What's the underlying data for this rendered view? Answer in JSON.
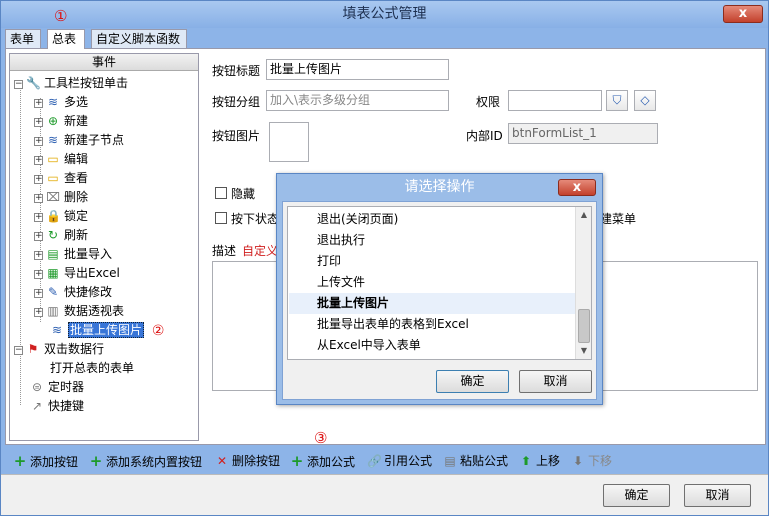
{
  "window": {
    "title": "填表公式管理",
    "close": "x"
  },
  "markers": {
    "m1": "①",
    "m2": "②",
    "m3": "③"
  },
  "tabs": [
    {
      "label": "表单"
    },
    {
      "label": "总表"
    },
    {
      "label": "自定义脚本函数"
    }
  ],
  "left_panel": {
    "header": "事件",
    "tree": [
      {
        "label": "工具栏按钮单击",
        "icon": "🔧",
        "expand": "−"
      },
      {
        "label": "多选",
        "icon": "≋",
        "expand": "+"
      },
      {
        "label": "新建",
        "icon": "⊕",
        "expand": "+"
      },
      {
        "label": "新建子节点",
        "icon": "≋",
        "expand": "+"
      },
      {
        "label": "编辑",
        "icon": "▭",
        "expand": "+"
      },
      {
        "label": "查看",
        "icon": "▭",
        "expand": "+"
      },
      {
        "label": "删除",
        "icon": "⌧",
        "expand": "+"
      },
      {
        "label": "锁定",
        "icon": "🔒",
        "expand": "+"
      },
      {
        "label": "刷新",
        "icon": "↻",
        "expand": "+"
      },
      {
        "label": "批量导入",
        "icon": "▤",
        "expand": "+"
      },
      {
        "label": "导出Excel",
        "icon": "▦",
        "expand": "+"
      },
      {
        "label": "快捷修改",
        "icon": "✎",
        "expand": "+"
      },
      {
        "label": "数据透视表",
        "icon": "▥",
        "expand": "+"
      },
      {
        "label": "批量上传图片",
        "icon": "≋",
        "expand": ""
      },
      {
        "label": "双击数据行",
        "icon": "⚑",
        "expand": "−"
      },
      {
        "label": "打开总表的表单",
        "icon": "",
        "expand": ""
      },
      {
        "label": "定时器",
        "icon": "⊜",
        "expand": ""
      },
      {
        "label": "快捷键",
        "icon": "↗",
        "expand": ""
      }
    ]
  },
  "form": {
    "title_label": "按钮标题",
    "title_value": "批量上传图片",
    "group_label": "按钮分组",
    "group_placeholder": "加入\\表示多级分组",
    "perm_label": "权限",
    "perm_value": "",
    "shield_icon": "⛉",
    "eraser_icon": "◇",
    "image_label": "按钮图片",
    "id_label": "内部ID",
    "id_value": "btnFormList_1",
    "hidden_label": "隐藏",
    "pressed_label": "按下状态",
    "menu_label": "建菜单",
    "desc_label": "描述",
    "desc_link": "自定义"
  },
  "modal": {
    "title": "请选择操作",
    "close": "x",
    "items": [
      {
        "label": "退出(关闭页面)"
      },
      {
        "label": "退出执行"
      },
      {
        "label": "打印"
      },
      {
        "label": "上传文件"
      },
      {
        "label": "批量上传图片"
      },
      {
        "label": "批量导出表单的表格到Excel"
      },
      {
        "label": "从Excel中导入表单"
      }
    ],
    "selected_index": 4,
    "ok": "确定",
    "cancel": "取消"
  },
  "toolbar": [
    {
      "label": "添加按钮",
      "icon": "+"
    },
    {
      "label": "添加系统内置按钮",
      "icon": "+"
    },
    {
      "label": "删除按钮",
      "icon": "✕"
    },
    {
      "label": "添加公式",
      "icon": "+"
    },
    {
      "label": "引用公式",
      "icon": "🔗"
    },
    {
      "label": "粘贴公式",
      "icon": "▤"
    },
    {
      "label": "上移",
      "icon": "⬆"
    },
    {
      "label": "下移",
      "icon": "⬇"
    }
  ],
  "footer": {
    "ok": "确定",
    "cancel": "取消"
  }
}
